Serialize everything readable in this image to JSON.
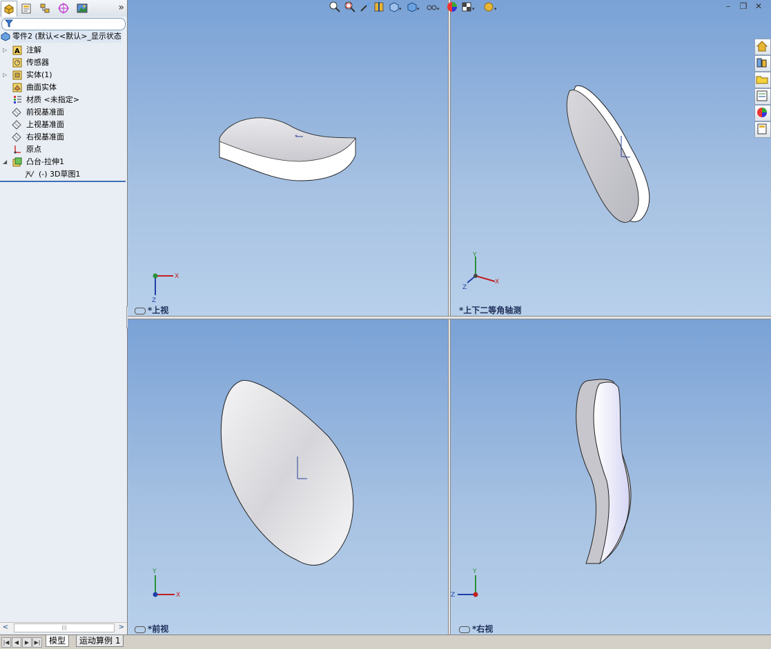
{
  "feature_tree": {
    "root_label": "零件2 (默认<<默认>_显示状态",
    "items": [
      {
        "label": "注解",
        "icon": "annotation-icon",
        "expandable": true
      },
      {
        "label": "传感器",
        "icon": "sensor-icon",
        "expandable": false
      },
      {
        "label": "实体(1)",
        "icon": "solid-body-icon",
        "expandable": true
      },
      {
        "label": "曲面实体",
        "icon": "surface-body-icon",
        "expandable": false
      },
      {
        "label": "材质 <未指定>",
        "icon": "material-icon",
        "expandable": false
      },
      {
        "label": "前视基准面",
        "icon": "plane-icon",
        "expandable": false
      },
      {
        "label": "上视基准面",
        "icon": "plane-icon",
        "expandable": false
      },
      {
        "label": "右视基准面",
        "icon": "plane-icon",
        "expandable": false
      },
      {
        "label": "原点",
        "icon": "origin-icon",
        "expandable": false
      },
      {
        "label": "凸台-拉伸1",
        "icon": "extrude-icon",
        "expandable": true,
        "expanded": true
      },
      {
        "label": "(-) 3D草图1",
        "icon": "sketch3d-icon",
        "expandable": false,
        "child": true
      }
    ]
  },
  "left_tabs": [
    "feature-manager-icon",
    "property-manager-icon",
    "configuration-manager-icon",
    "dimxpert-icon",
    "display-manager-icon"
  ],
  "viewports": {
    "top": {
      "label": "*上视"
    },
    "iso": {
      "label": "*上下二等角轴测"
    },
    "front": {
      "label": "*前视"
    },
    "right": {
      "label": "*右视"
    }
  },
  "axes": {
    "x": "X",
    "y": "Y",
    "z": "Z"
  },
  "bottom_tabs": {
    "model": "模型",
    "motion": "运动算例 1"
  },
  "window_controls": [
    "minimize-icon",
    "restore-icon",
    "close-icon"
  ],
  "colors": {
    "viewport_top": "#7aa2d6",
    "viewport_bottom": "#b8d0ea",
    "selection_line": "#3d6fb6"
  }
}
